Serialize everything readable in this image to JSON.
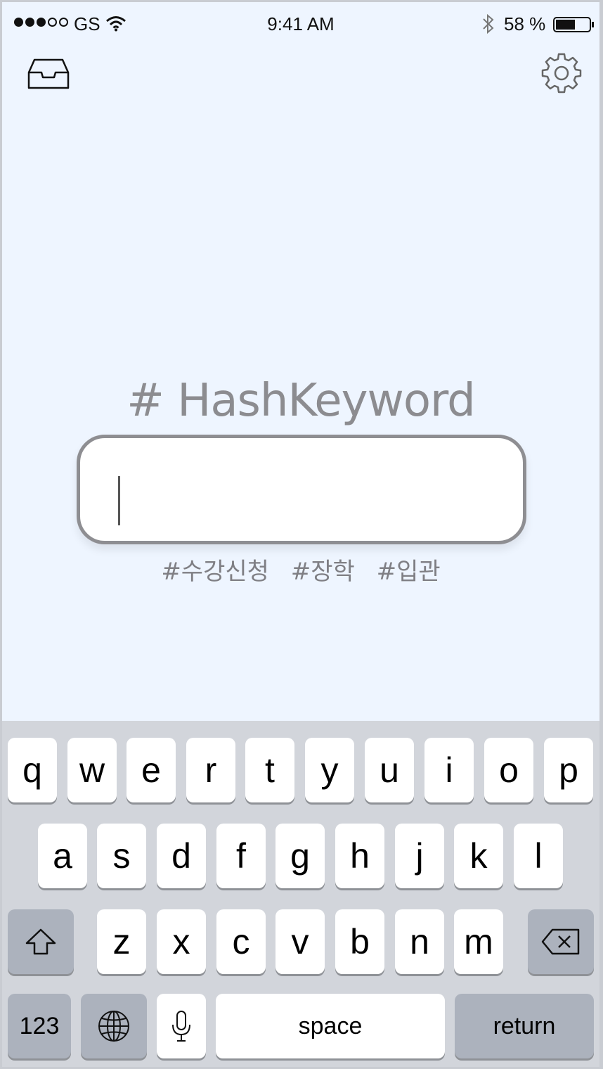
{
  "status_bar": {
    "carrier": "GS",
    "time": "9:41 AM",
    "battery_text": "58 %",
    "battery_level": 0.58
  },
  "toolbar": {
    "inbox_icon": "inbox-tray-icon",
    "settings_icon": "gear-icon"
  },
  "main": {
    "title": "# HashKeyword",
    "search": {
      "value": "",
      "placeholder": ""
    },
    "suggested_tags": [
      "#수강신청",
      "#장학",
      "#입관"
    ]
  },
  "keyboard": {
    "row1": [
      "q",
      "w",
      "e",
      "r",
      "t",
      "y",
      "u",
      "i",
      "o",
      "p"
    ],
    "row2": [
      "a",
      "s",
      "d",
      "f",
      "g",
      "h",
      "j",
      "k",
      "l"
    ],
    "row3": [
      "z",
      "x",
      "c",
      "v",
      "b",
      "n",
      "m"
    ],
    "numbers_label": "123",
    "space_label": "space",
    "return_label": "return",
    "shift_icon": "shift-arrow-icon",
    "delete_icon": "backspace-icon",
    "globe_icon": "globe-icon",
    "mic_icon": "microphone-icon"
  },
  "colors": {
    "background": "#eef5ff",
    "title_gray": "#8c8c90",
    "keyboard_bg": "#d2d5db",
    "dark_key": "#acb2bd"
  }
}
